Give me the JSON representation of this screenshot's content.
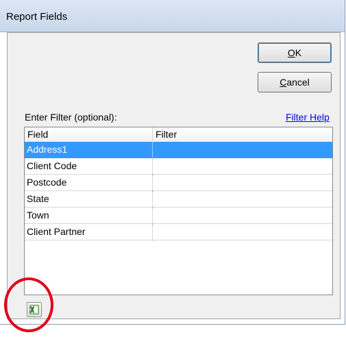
{
  "window": {
    "title": "Report Fields"
  },
  "buttons": {
    "ok": {
      "accel": "O",
      "rest": "K"
    },
    "cancel": {
      "accel": "C",
      "rest": "ancel"
    }
  },
  "filter": {
    "label": "Enter Filter (optional):",
    "help_link": "Filter Help"
  },
  "grid": {
    "columns": [
      "Field",
      "Filter"
    ],
    "rows": [
      {
        "field": "Address1",
        "filter": "",
        "selected": true
      },
      {
        "field": "Client Code",
        "filter": ""
      },
      {
        "field": "Postcode",
        "filter": ""
      },
      {
        "field": "State",
        "filter": ""
      },
      {
        "field": "Town",
        "filter": ""
      },
      {
        "field": "Client Partner",
        "filter": ""
      }
    ]
  },
  "export_button": {
    "icon": "excel-icon"
  },
  "annotation": {
    "color": "#e0001b"
  },
  "colors": {
    "selection": "#3399ff",
    "link": "#0000ee"
  }
}
